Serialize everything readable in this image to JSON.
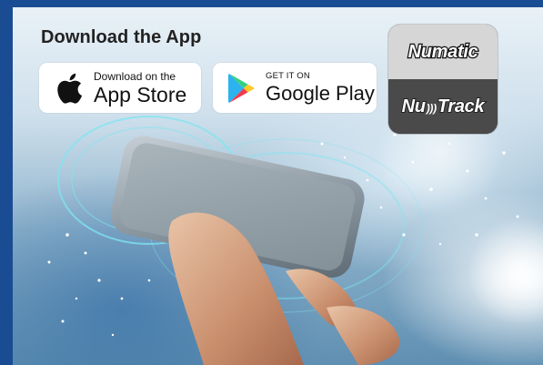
{
  "page": {
    "heading": "Download the App"
  },
  "badges": {
    "app_store": {
      "small": "Download on the",
      "big": "App Store",
      "icon": "apple-icon"
    },
    "google_play": {
      "small": "GET IT ON",
      "big": "Google Play",
      "icon": "google-play-icon"
    }
  },
  "logos": {
    "top": "Numatic",
    "bottom_a": "Nu",
    "bottom_b": "Track"
  },
  "colors": {
    "frame": "#1a4c93",
    "logo_top": "#d6d6d6",
    "logo_bottom": "#4a4a4a"
  }
}
